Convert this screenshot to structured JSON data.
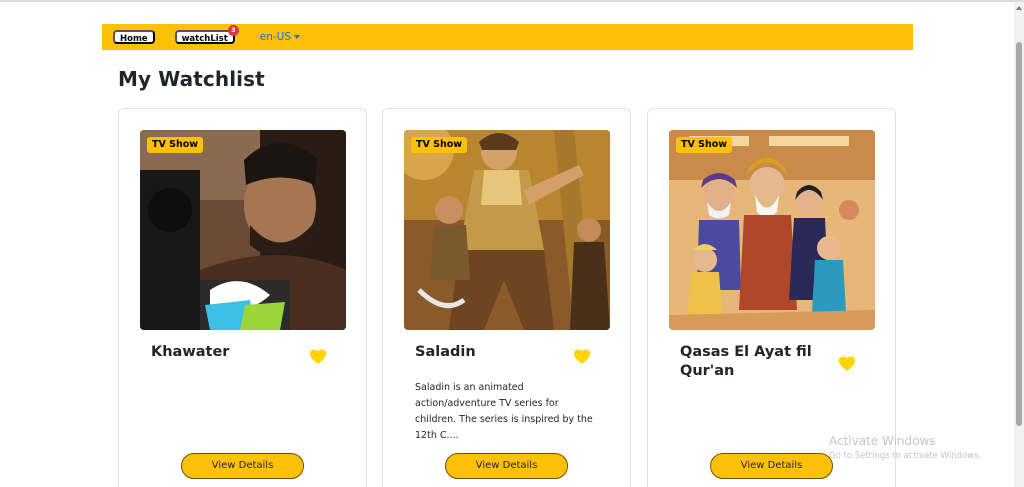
{
  "navbar": {
    "home_label": "Home",
    "watchlist_label": "watchList",
    "watchlist_count": "3",
    "language_label": "en-US"
  },
  "page": {
    "title": "My Watchlist"
  },
  "cards": [
    {
      "badge": "TV Show",
      "title": "Khawater",
      "description": "",
      "button_label": "View Details"
    },
    {
      "badge": "TV Show",
      "title": "Saladin",
      "description": "Saladin is an animated action/adventure TV series for children. The series is inspired by the 12th C....",
      "button_label": "View Details"
    },
    {
      "badge": "TV Show",
      "title": "Qasas El Ayat fil Qur'an",
      "description": "",
      "button_label": "View Details"
    }
  ],
  "watermark": {
    "line1": "Activate Windows",
    "line2": "Go to Settings to activate Windows."
  },
  "colors": {
    "accent": "#ffc107",
    "heart": "#ffd400",
    "badge_red": "#dc3545",
    "link_blue": "#0d6efd"
  },
  "icons": {
    "favorite": "heart-icon",
    "dropdown": "caret-down-icon"
  }
}
